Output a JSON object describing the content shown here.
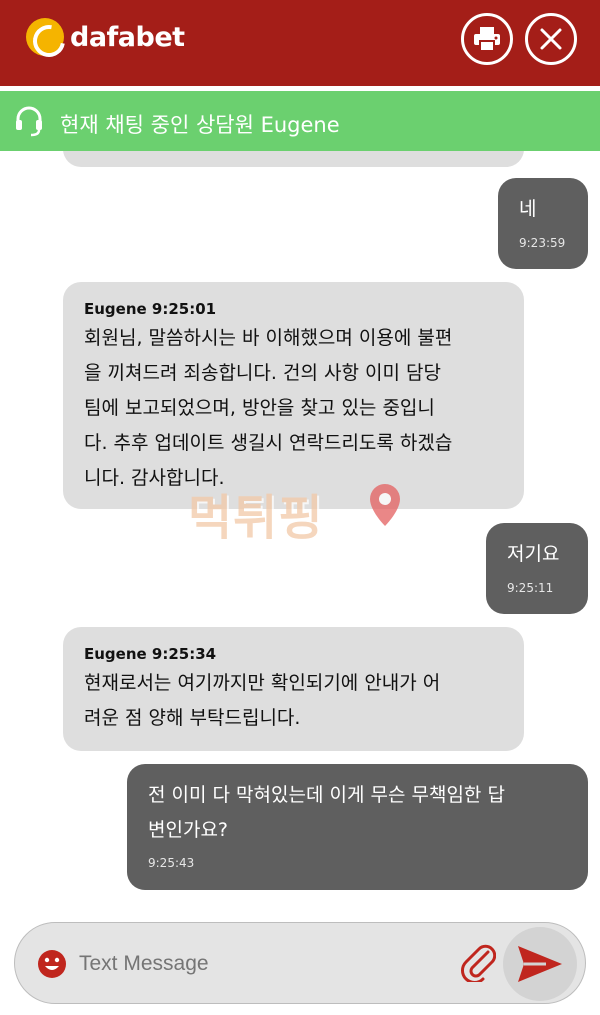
{
  "header": {
    "brand": "dafabet",
    "print_icon": "printer-icon",
    "close_icon": "close-icon"
  },
  "agent_bar": {
    "icon": "headset-icon",
    "text": "현재 채팅 중인 상담원 Eugene"
  },
  "messages": [
    {
      "from": "me",
      "text": "네",
      "time": "9:23:59"
    },
    {
      "from": "agent",
      "sender": "Eugene 9:25:01",
      "lines": [
        "회원님, 말씀하시는 바 이해했으며 이용에 불편",
        "을 끼쳐드려 죄송합니다. 건의 사항 이미 담당",
        "팀에 보고되었으며, 방안을 찾고 있는 중입니",
        "다. 추후 업데이트 생길시 연락드리도록 하겠습",
        "니다. 감사합니다."
      ]
    },
    {
      "from": "me",
      "text": "저기요",
      "time": "9:25:11"
    },
    {
      "from": "agent",
      "sender": "Eugene 9:25:34",
      "lines": [
        "현재로서는 여기까지만 확인되기에 안내가 어",
        "려운 점 양해 부탁드립니다."
      ]
    },
    {
      "from": "me",
      "lines": [
        "전 이미 다 막혀있는데 이게 무슨 무책임한 답",
        "변인가요?"
      ],
      "time": "9:25:43"
    }
  ],
  "composer": {
    "placeholder": "Text Message",
    "emoji_icon": "smiley-icon",
    "attach_icon": "paperclip-icon",
    "send_icon": "send-icon"
  },
  "watermark": {
    "text": "먹튀핑"
  },
  "colors": {
    "header_bg": "#a41e18",
    "agent_bar_bg": "#6bd06f",
    "agent_bubble": "#dedede",
    "user_bubble": "#5f5f5f",
    "icon_red": "#c0261e"
  }
}
